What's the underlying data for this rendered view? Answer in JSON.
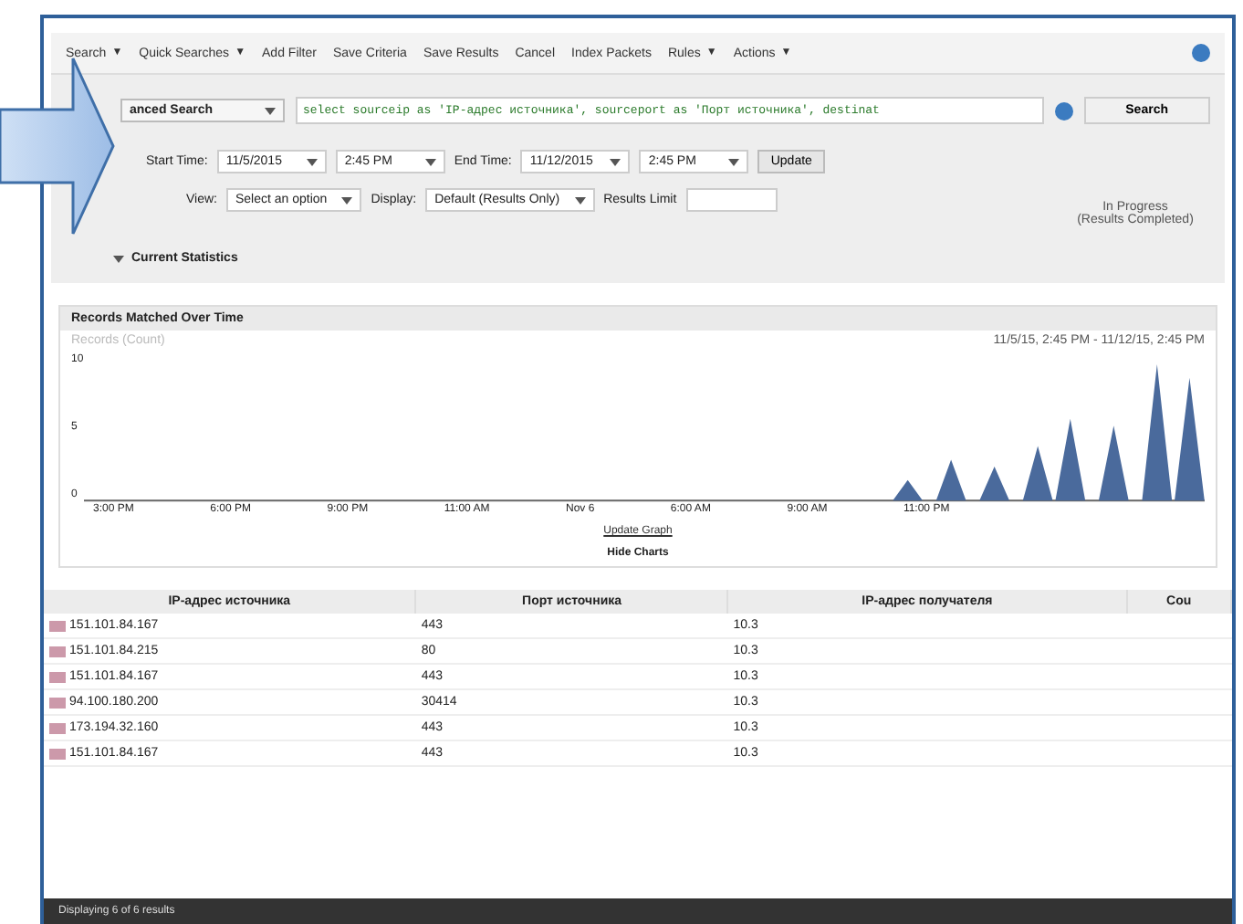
{
  "toolbar": {
    "items": [
      {
        "label": "Search",
        "caret": "▼"
      },
      {
        "label": "Quick Searches",
        "caret": "▼"
      },
      {
        "label": "Add Filter"
      },
      {
        "label": "Save Criteria"
      },
      {
        "label": "Save Results"
      },
      {
        "label": "Cancel"
      },
      {
        "label": "Index Packets"
      },
      {
        "label": "Rules",
        "caret": "▼"
      },
      {
        "label": "Actions",
        "caret": "▼"
      }
    ]
  },
  "search": {
    "mode": "anced Search",
    "query": "select sourceip as 'IP-адрес источника', sourceport as 'Порт источника', destinat",
    "button": "Search"
  },
  "time": {
    "start_label": "Start Time:",
    "start_date": "11/5/2015",
    "start_time": "2:45 PM",
    "end_label": "End Time:",
    "end_date": "11/12/2015",
    "end_time": "2:45 PM",
    "update": "Update"
  },
  "options": {
    "view_label": "View:",
    "view_value": "Select an option",
    "display_label": "Display:",
    "display_value": "Default (Results Only)",
    "limit_label": "Results Limit"
  },
  "progress": {
    "line1": "In Progress",
    "line2": "(Results Completed)"
  },
  "statistics": {
    "label": "Current Statistics",
    "expanded": true
  },
  "chart": {
    "title": "Records Matched Over Time",
    "ylabel": "Records (Count)",
    "range": "11/5/15, 2:45 PM - 11/12/15, 2:45 PM",
    "yticks": [
      "10",
      "5",
      "0"
    ],
    "xticks": [
      "3:00 PM",
      "6:00 PM",
      "9:00 PM",
      "11:00 AM",
      "Nov 6",
      "6:00 AM",
      "9:00 AM",
      "11:00 PM"
    ],
    "link": "Update Graph",
    "hide": "Hide Charts"
  },
  "table": {
    "columns": [
      "IP-адрес источника",
      "Порт источника",
      "IP-адрес получателя",
      "Cou"
    ],
    "rows": [
      [
        "151.101.84.167",
        "443",
        "10.3"
      ],
      [
        "151.101.84.215",
        "80",
        "10.3"
      ],
      [
        "151.101.84.167",
        "443",
        "10.3"
      ],
      [
        "94.100.180.200",
        "30414",
        "10.3"
      ],
      [
        "173.194.32.160",
        "443",
        "10.3"
      ],
      [
        "151.101.84.167",
        "443",
        "10.3"
      ]
    ]
  },
  "status_bar": "Displaying 6 of 6 results"
}
